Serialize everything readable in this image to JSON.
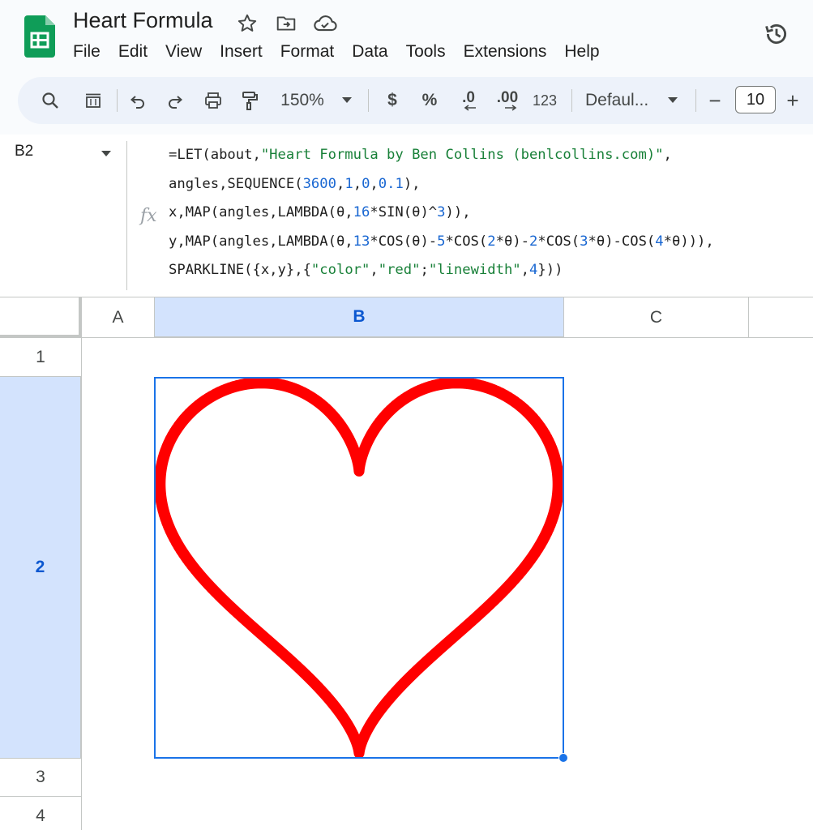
{
  "title_bar": {
    "doc_title": "Heart Formula",
    "icons": [
      "star-icon",
      "move-to-folder-icon",
      "cloud-saved-icon"
    ]
  },
  "menu": {
    "items": [
      "File",
      "Edit",
      "View",
      "Insert",
      "Format",
      "Data",
      "Tools",
      "Extensions",
      "Help"
    ]
  },
  "history_icon": "version-history-icon",
  "toolbar": {
    "zoom": "150%",
    "currency": "$",
    "percent": "%",
    "decrease_decimal": ".0",
    "increase_decimal": ".00",
    "more_formats": "123",
    "font": "Defaul...",
    "font_size": "10",
    "minus": "−",
    "plus": "+"
  },
  "formula_bar": {
    "cell_ref": "B2",
    "fx": "fx",
    "lines": [
      "=LET(about,\"Heart Formula by Ben Collins (benlcollins.com)\",",
      "angles,SEQUENCE(3600,1,0,0.1),",
      "x,MAP(angles,LAMBDA(θ,16*SIN(θ)^3)),",
      "y,MAP(angles,LAMBDA(θ,13*COS(θ)-5*COS(2*θ)-2*COS(3*θ)-COS(4*θ))),",
      "SPARKLINE({x,y},{\"color\",\"red\";\"linewidth\",4}))"
    ]
  },
  "grid": {
    "columns": [
      "A",
      "B",
      "C"
    ],
    "rows": [
      "1",
      "2",
      "3",
      "4"
    ],
    "selected_cell": "B2"
  },
  "sparkline": {
    "color": "#ff0000",
    "linewidth": 4,
    "x_formula": "16*SIN(θ)^3",
    "y_formula": "13*COS(θ)-5*COS(2*θ)-2*COS(3*θ)-COS(4*θ)",
    "points": 3600,
    "start": 0,
    "step": 0.1
  },
  "colors": {
    "accent": "#1a73e8",
    "selected_header": "#d3e3fd",
    "sheets_green": "#0f9d58",
    "toolbar_bg": "#edf2fa"
  }
}
